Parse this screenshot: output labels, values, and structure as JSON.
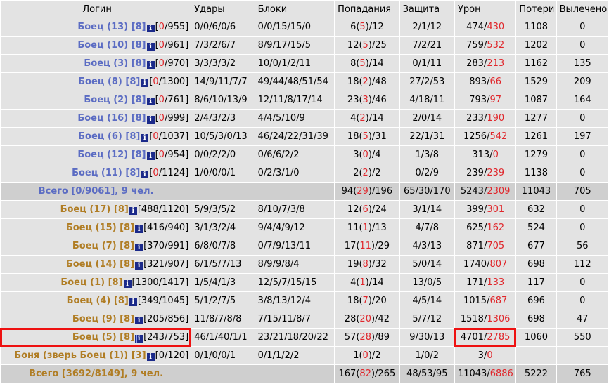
{
  "headers": [
    "Логин",
    "Удары",
    "Блоки",
    "Попадания",
    "Защита",
    "Урон",
    "Потери",
    "Вылечено"
  ],
  "team1": [
    {
      "name": "Боец (13) [8]",
      "info": "i",
      "hp_a": "0",
      "hp_b": "955",
      "hits": "0/0/6/0/6",
      "blocks": "0/0/15/15/0",
      "acc_a": "6",
      "acc_b": "5",
      "acc_c": "12",
      "def": "2/1/12",
      "dmg_a": "474",
      "dmg_b": "430",
      "loss": "1108",
      "heal": "0"
    },
    {
      "name": "Боец (10) [8]",
      "info": "i",
      "hp_a": "0",
      "hp_b": "961",
      "hits": "7/3/2/6/7",
      "blocks": "8/9/17/15/5",
      "acc_a": "12",
      "acc_b": "5",
      "acc_c": "25",
      "def": "7/2/21",
      "dmg_a": "759",
      "dmg_b": "532",
      "loss": "1202",
      "heal": "0"
    },
    {
      "name": "Боец (3) [8]",
      "info": "i",
      "hp_a": "0",
      "hp_b": "970",
      "hits": "3/3/3/3/2",
      "blocks": "10/0/1/2/11",
      "acc_a": "8",
      "acc_b": "5",
      "acc_c": "14",
      "def": "0/1/11",
      "dmg_a": "283",
      "dmg_b": "213",
      "loss": "1162",
      "heal": "135"
    },
    {
      "name": "Боец (8) [8]",
      "info": "i",
      "hp_a": "0",
      "hp_b": "1300",
      "hits": "14/9/11/7/7",
      "blocks": "49/44/48/51/54",
      "acc_a": "18",
      "acc_b": "2",
      "acc_c": "48",
      "def": "27/2/53",
      "dmg_a": "893",
      "dmg_b": "66",
      "loss": "1529",
      "heal": "209"
    },
    {
      "name": "Боец (2) [8]",
      "info": "i",
      "hp_a": "0",
      "hp_b": "761",
      "hits": "8/6/10/13/9",
      "blocks": "12/11/8/17/14",
      "acc_a": "23",
      "acc_b": "3",
      "acc_c": "46",
      "def": "4/18/11",
      "dmg_a": "793",
      "dmg_b": "97",
      "loss": "1087",
      "heal": "164"
    },
    {
      "name": "Боец (16) [8]",
      "info": "i",
      "hp_a": "0",
      "hp_b": "999",
      "hits": "2/4/3/2/3",
      "blocks": "4/4/5/10/9",
      "acc_a": "4",
      "acc_b": "2",
      "acc_c": "14",
      "def": "2/0/14",
      "dmg_a": "233",
      "dmg_b": "190",
      "loss": "1277",
      "heal": "0"
    },
    {
      "name": "Боец (6) [8]",
      "info": "i",
      "hp_a": "0",
      "hp_b": "1037",
      "hits": "10/5/3/0/13",
      "blocks": "46/24/22/31/39",
      "acc_a": "18",
      "acc_b": "5",
      "acc_c": "31",
      "def": "22/1/31",
      "dmg_a": "1256",
      "dmg_b": "542",
      "loss": "1261",
      "heal": "197"
    },
    {
      "name": "Боец (12) [8]",
      "info": "i",
      "hp_a": "0",
      "hp_b": "954",
      "hits": "0/0/2/2/0",
      "blocks": "0/6/6/2/2",
      "acc_a": "3",
      "acc_b": "0",
      "acc_c": "4",
      "def": "1/3/8",
      "dmg_a": "313",
      "dmg_b": "0",
      "loss": "1279",
      "heal": "0"
    },
    {
      "name": "Боец (11) [8]",
      "info": "i",
      "hp_a": "0",
      "hp_b": "1124",
      "hits": "1/0/0/0/1",
      "blocks": "0/2/3/1/0",
      "acc_a": "2",
      "acc_b": "2",
      "acc_c": "2",
      "def": "0/2/9",
      "dmg_a": "239",
      "dmg_b": "239",
      "loss": "1138",
      "heal": "0"
    }
  ],
  "team1_total": {
    "label": "Всего [0/9061], 9 чел.",
    "acc_a": "94",
    "acc_b": "29",
    "acc_c": "196",
    "def": "65/30/170",
    "dmg_a": "5243",
    "dmg_b": "2309",
    "loss": "11043",
    "heal": "705"
  },
  "team2": [
    {
      "name": "Боец (17) [8]",
      "info": "i",
      "hp": "[488/1120]",
      "hits": "5/9/3/5/2",
      "blocks": "8/10/7/3/8",
      "acc_a": "12",
      "acc_b": "6",
      "acc_c": "24",
      "def": "3/1/14",
      "dmg_a": "399",
      "dmg_b": "301",
      "loss": "632",
      "heal": "0"
    },
    {
      "name": "Боец (15) [8]",
      "info": "i",
      "hp": "[416/940]",
      "hits": "3/1/3/2/4",
      "blocks": "9/4/4/9/12",
      "acc_a": "11",
      "acc_b": "1",
      "acc_c": "13",
      "def": "4/7/8",
      "dmg_a": "625",
      "dmg_b": "162",
      "loss": "524",
      "heal": "0"
    },
    {
      "name": "Боец (7) [8]",
      "info": "i",
      "hp": "[370/991]",
      "hits": "6/8/0/7/8",
      "blocks": "0/7/9/13/11",
      "acc_a": "17",
      "acc_b": "11",
      "acc_c": "29",
      "def": "4/3/13",
      "dmg_a": "871",
      "dmg_b": "705",
      "loss": "677",
      "heal": "56"
    },
    {
      "name": "Боец (14) [8]",
      "info": "i",
      "hp": "[321/907]",
      "hits": "6/1/5/7/13",
      "blocks": "8/9/9/8/4",
      "acc_a": "19",
      "acc_b": "8",
      "acc_c": "32",
      "def": "5/0/14",
      "dmg_a": "1740",
      "dmg_b": "807",
      "loss": "698",
      "heal": "112"
    },
    {
      "name": "Боец (1) [8]",
      "info": "i",
      "hp": "[1300/1417]",
      "hits": "1/5/4/1/3",
      "blocks": "12/5/7/15/15",
      "acc_a": "4",
      "acc_b": "1",
      "acc_c": "14",
      "def": "13/0/5",
      "dmg_a": "171",
      "dmg_b": "133",
      "loss": "117",
      "heal": "0"
    },
    {
      "name": "Боец (4) [8]",
      "info": "i",
      "hp": "[349/1045]",
      "hits": "5/1/2/7/5",
      "blocks": "3/8/13/12/4",
      "acc_a": "18",
      "acc_b": "7",
      "acc_c": "20",
      "def": "4/5/14",
      "dmg_a": "1015",
      "dmg_b": "687",
      "loss": "696",
      "heal": "0"
    },
    {
      "name": "Боец (9) [8]",
      "info": "i",
      "hp": "[205/856]",
      "hits": "11/8/7/8/8",
      "blocks": "7/15/11/8/7",
      "acc_a": "28",
      "acc_b": "20",
      "acc_c": "42",
      "def": "5/7/12",
      "dmg_a": "1518",
      "dmg_b": "1306",
      "loss": "698",
      "heal": "47"
    },
    {
      "name": "Боец (5) [8]",
      "info": "i",
      "hp": "[243/753]",
      "hits": "46/1/40/1/1",
      "blocks": "23/21/18/20/22",
      "acc_a": "57",
      "acc_b": "28",
      "acc_c": "89",
      "def": "9/30/13",
      "dmg_a": "4701",
      "dmg_b": "2785",
      "loss": "1060",
      "heal": "550",
      "highlight": true
    },
    {
      "name": "Боня (зверь Боец (1)) [3]",
      "info": "i",
      "hp": "[0/120]",
      "hits": "0/1/0/0/1",
      "blocks": "0/1/1/2/2",
      "acc_a": "1",
      "acc_b": "0",
      "acc_c": "2",
      "def": "1/0/2",
      "dmg_a": "3",
      "dmg_b": "0",
      "loss": "",
      "heal": ""
    }
  ],
  "team2_total": {
    "label": "Всего [3692/8149], 9 чел.",
    "acc_a": "167",
    "acc_b": "82",
    "acc_c": "265",
    "def": "48/53/95",
    "dmg_a": "11043",
    "dmg_b": "6886",
    "loss": "5222",
    "heal": "765"
  }
}
